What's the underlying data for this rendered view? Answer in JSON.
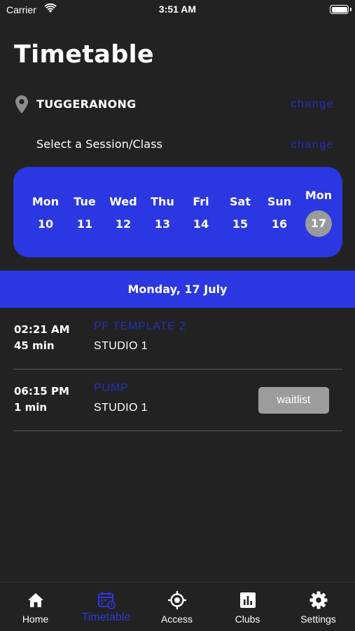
{
  "status_bar": {
    "carrier": "Carrier",
    "time": "3:51 AM"
  },
  "page": {
    "title": "Timetable"
  },
  "location": {
    "label": "TUGGERANONG",
    "change_label": "change"
  },
  "session_select": {
    "label": "Select a Session/Class",
    "change_label": "change"
  },
  "week": {
    "days": [
      {
        "name": "Mon",
        "num": "10"
      },
      {
        "name": "Tue",
        "num": "11"
      },
      {
        "name": "Wed",
        "num": "12"
      },
      {
        "name": "Thu",
        "num": "13"
      },
      {
        "name": "Fri",
        "num": "14"
      },
      {
        "name": "Sat",
        "num": "15"
      },
      {
        "name": "Sun",
        "num": "16"
      },
      {
        "name": "Mon",
        "num": "17"
      }
    ],
    "selected_index": 7
  },
  "selected_date": "Monday, 17 July",
  "sessions": [
    {
      "time": "02:21 AM",
      "duration": "45 min",
      "name": "PF TEMPLATE 2",
      "location": "STUDIO 1"
    },
    {
      "time": "06:15 PM",
      "duration": "1 min",
      "name": "PUMP",
      "location": "STUDIO 1",
      "action": "waitlist"
    }
  ],
  "tabs": [
    {
      "label": "Home",
      "icon": "home-icon"
    },
    {
      "label": "Timetable",
      "icon": "calendar-icon",
      "active": true
    },
    {
      "label": "Access",
      "icon": "access-target-icon"
    },
    {
      "label": "Clubs",
      "icon": "bar-chart-icon"
    },
    {
      "label": "Settings",
      "icon": "gear-icon"
    }
  ],
  "colors": {
    "background": "#222222",
    "accent": "#2b37e0",
    "link": "#2230b8",
    "selected_day": "#9a9a9a",
    "button": "#9c9c9c"
  }
}
